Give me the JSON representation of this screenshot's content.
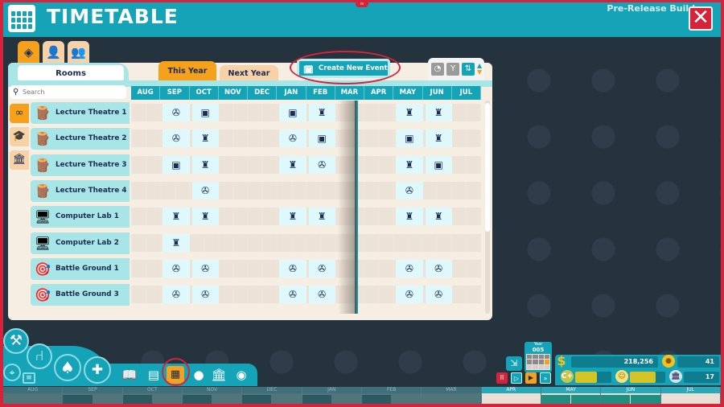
{
  "window": {
    "title": "TIMETABLE",
    "build_label": "Pre-Release Build",
    "close_icon": "close-x-icon",
    "pause_flag": "II"
  },
  "category_tabs": [
    {
      "name": "rooms-category",
      "icon": "room-cube-icon",
      "active": true
    },
    {
      "name": "staff-category",
      "icon": "person-icon",
      "active": false
    },
    {
      "name": "groups-category",
      "icon": "group-icon",
      "active": false
    }
  ],
  "panel": {
    "rooms_tab_label": "Rooms",
    "year_tabs": [
      {
        "label": "This Year",
        "active": true
      },
      {
        "label": "Next Year",
        "active": false
      }
    ],
    "create_event_label": "Create New Event",
    "search_placeholder": "Search",
    "view_tools": [
      {
        "icon": "timer-icon",
        "active": false
      },
      {
        "icon": "filter-icon",
        "active": false
      },
      {
        "icon": "sort-icon",
        "active": true
      }
    ],
    "filters": [
      {
        "icon": "infinity-icon",
        "active": true
      },
      {
        "icon": "graduation-cap-icon",
        "active": false
      },
      {
        "icon": "add-building-icon",
        "active": false
      }
    ],
    "months": [
      "AUG",
      "SEP",
      "OCT",
      "NOV",
      "DEC",
      "JAN",
      "FEB",
      "MAR",
      "APR",
      "MAY",
      "JUN",
      "JUL"
    ],
    "rooms": [
      {
        "name": "Lecture Theatre 1",
        "type": "lectern",
        "events": {
          "SEP": "projector",
          "OCT": "screen",
          "JAN": "screen",
          "FEB": "tophat",
          "MAY": "tophat",
          "JUN": "tophat"
        }
      },
      {
        "name": "Lecture Theatre 2",
        "type": "lectern",
        "events": {
          "SEP": "projector",
          "OCT": "tophat",
          "JAN": "projector",
          "FEB": "screen",
          "MAY": "screen",
          "JUN": "tophat"
        }
      },
      {
        "name": "Lecture Theatre 3",
        "type": "lectern",
        "events": {
          "SEP": "screen",
          "OCT": "tophat",
          "JAN": "tophat",
          "FEB": "projector",
          "MAY": "tophat",
          "JUN": "screen"
        }
      },
      {
        "name": "Lecture Theatre 4",
        "type": "lectern",
        "events": {
          "OCT": "projector",
          "MAY": "projector"
        }
      },
      {
        "name": "Computer Lab 1",
        "type": "computer",
        "events": {
          "SEP": "tophat",
          "OCT": "tophat",
          "JAN": "tophat",
          "FEB": "tophat",
          "MAY": "tophat",
          "JUN": "tophat"
        }
      },
      {
        "name": "Computer Lab 2",
        "type": "computer",
        "events": {
          "SEP": "tophat"
        }
      },
      {
        "name": "Battle Ground 1",
        "type": "dummy",
        "events": {
          "SEP": "projector",
          "OCT": "projector",
          "JAN": "projector",
          "FEB": "projector",
          "MAY": "projector",
          "JUN": "projector"
        }
      },
      {
        "name": "Battle Ground 3",
        "type": "dummy",
        "events": {
          "SEP": "projector",
          "OCT": "projector",
          "JAN": "projector",
          "FEB": "projector",
          "MAY": "projector",
          "JUN": "projector"
        }
      }
    ]
  },
  "toolbar": {
    "tools": [
      "build-hammer-icon",
      "furniture-chair-icon",
      "nature-tree-icon",
      "hire-staff-icon",
      "map-icon",
      "list-icon",
      "book-icon",
      "newspaper-icon",
      "timetable-calendar-icon",
      "person-icon",
      "university-building-icon",
      "eye-icon"
    ],
    "active_tool": "timetable-calendar-icon"
  },
  "hud": {
    "year_label": "Year",
    "year_value": "005",
    "money": "218,256",
    "research_points": "41",
    "grade_progress": 0.6,
    "happiness_progress": 0.72,
    "prestige": "17",
    "speed_controls": [
      "pause",
      "play",
      "fast",
      "fastest"
    ],
    "active_speed": "fast"
  },
  "timeline": {
    "months": [
      "AUG",
      "SEP",
      "OCT",
      "NOV",
      "DEC",
      "JAN",
      "FEB",
      "MAR",
      "APR",
      "MAY",
      "JUN",
      "JUL"
    ],
    "current_month_index": 8
  }
}
